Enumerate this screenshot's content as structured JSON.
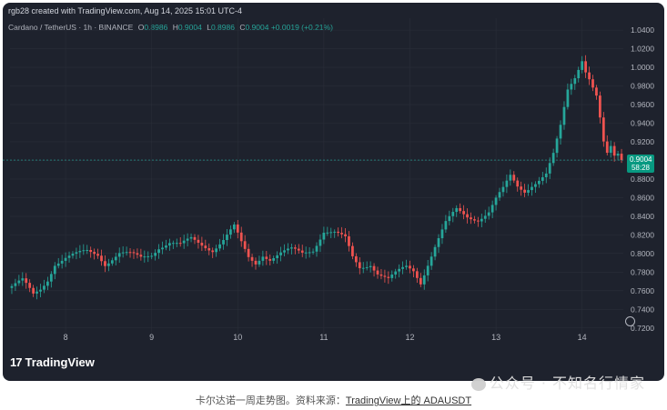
{
  "header": {
    "created_line": "rgb28 created with TradingView.com, Aug 14, 2025 15:01 UTC-4",
    "symbol": "Cardano / TetherUS · 1h · BINANCE",
    "ohlc": [
      {
        "label": "O",
        "value": "0.8986"
      },
      {
        "label": "H",
        "value": "0.9004"
      },
      {
        "label": "L",
        "value": "0.8986"
      },
      {
        "label": "C",
        "value": "0.9004"
      }
    ],
    "change": "+0.0019 (+0.21%)"
  },
  "last_price": {
    "value": "0.9004",
    "countdown": "58:28"
  },
  "branding": {
    "logo_mark": "17",
    "logo_text": "TradingView"
  },
  "watermark": {
    "text": "公众号 · 不知名行情家"
  },
  "caption": {
    "prefix": "卡尔达诺一周走势图。资料来源：",
    "link": "TradingView上的 ADAUSDT"
  },
  "colors": {
    "up": "#26a69a",
    "down": "#ef5350",
    "background": "#1e222d",
    "grid": "#2a2e39",
    "axis_text": "#b2b5be"
  },
  "chart_data": {
    "type": "candlestick",
    "symbol": "ADAUSDT",
    "interval": "1h",
    "ylim": [
      0.71,
      1.045
    ],
    "y_ticks": [
      "1.0400",
      "1.0200",
      "1.0000",
      "0.9800",
      "0.9600",
      "0.9400",
      "0.9200",
      "0.9000",
      "0.8800",
      "0.8600",
      "0.8400",
      "0.8200",
      "0.8000",
      "0.7800",
      "0.7600",
      "0.7400",
      "0.7200"
    ],
    "x_ticks": [
      {
        "label": "8",
        "t": 15
      },
      {
        "label": "9",
        "t": 39
      },
      {
        "label": "10",
        "t": 63
      },
      {
        "label": "11",
        "t": 87
      },
      {
        "label": "12",
        "t": 111
      },
      {
        "label": "13",
        "t": 135
      },
      {
        "label": "14",
        "t": 159
      }
    ],
    "anchors": [
      [
        0,
        0.765
      ],
      [
        3,
        0.77
      ],
      [
        6,
        0.755
      ],
      [
        8,
        0.762
      ],
      [
        10,
        0.773
      ],
      [
        12,
        0.79
      ],
      [
        15,
        0.795
      ],
      [
        18,
        0.798
      ],
      [
        21,
        0.802
      ],
      [
        24,
        0.8
      ],
      [
        26,
        0.79
      ],
      [
        28,
        0.795
      ],
      [
        30,
        0.8
      ],
      [
        33,
        0.798
      ],
      [
        36,
        0.795
      ],
      [
        39,
        0.8
      ],
      [
        41,
        0.808
      ],
      [
        44,
        0.812
      ],
      [
        47,
        0.808
      ],
      [
        50,
        0.815
      ],
      [
        53,
        0.81
      ],
      [
        56,
        0.805
      ],
      [
        59,
        0.815
      ],
      [
        62,
        0.828
      ],
      [
        64,
        0.81
      ],
      [
        66,
        0.795
      ],
      [
        68,
        0.79
      ],
      [
        70,
        0.8
      ],
      [
        72,
        0.795
      ],
      [
        75,
        0.8
      ],
      [
        78,
        0.803
      ],
      [
        81,
        0.8
      ],
      [
        84,
        0.805
      ],
      [
        87,
        0.825
      ],
      [
        90,
        0.822
      ],
      [
        93,
        0.815
      ],
      [
        95,
        0.795
      ],
      [
        97,
        0.785
      ],
      [
        100,
        0.79
      ],
      [
        102,
        0.78
      ],
      [
        105,
        0.772
      ],
      [
        108,
        0.78
      ],
      [
        110,
        0.785
      ],
      [
        112,
        0.782
      ],
      [
        114,
        0.77
      ],
      [
        116,
        0.79
      ],
      [
        118,
        0.808
      ],
      [
        121,
        0.832
      ],
      [
        124,
        0.846
      ],
      [
        127,
        0.84
      ],
      [
        130,
        0.838
      ],
      [
        133,
        0.845
      ],
      [
        135,
        0.858
      ],
      [
        137,
        0.868
      ],
      [
        139,
        0.882
      ],
      [
        141,
        0.872
      ],
      [
        143,
        0.868
      ],
      [
        145,
        0.875
      ],
      [
        147,
        0.88
      ],
      [
        149,
        0.885
      ],
      [
        151,
        0.905
      ],
      [
        153,
        0.935
      ],
      [
        155,
        0.975
      ],
      [
        157,
        0.99
      ],
      [
        158,
        1.0
      ],
      [
        159,
        1.01
      ],
      [
        160,
        0.998
      ],
      [
        161,
        0.99
      ],
      [
        163,
        0.97
      ],
      [
        164,
        0.945
      ],
      [
        165,
        0.918
      ],
      [
        166,
        0.905
      ],
      [
        167,
        0.912
      ],
      [
        168,
        0.902
      ],
      [
        169,
        0.905
      ],
      [
        170,
        0.9
      ]
    ]
  }
}
